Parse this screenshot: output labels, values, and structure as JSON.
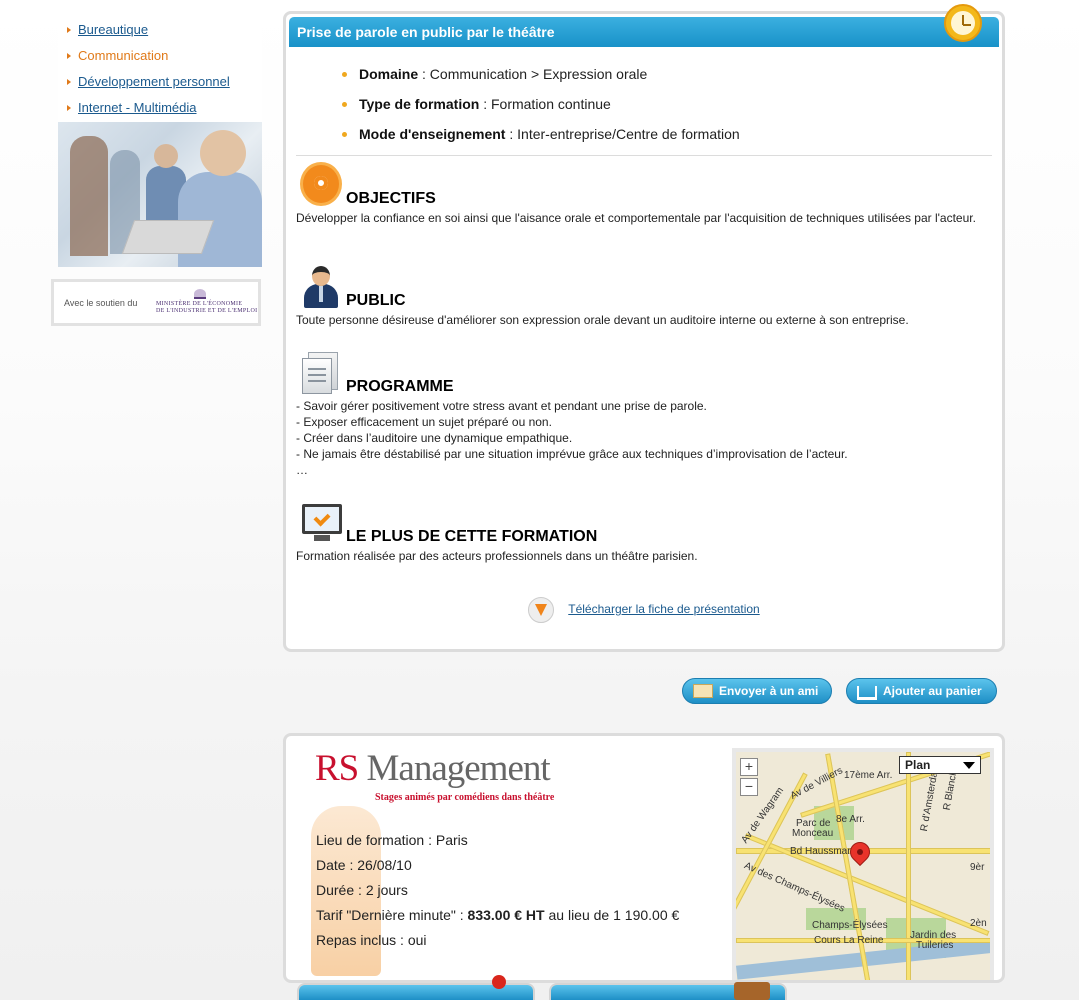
{
  "sidebar": {
    "menu": [
      {
        "label": "Bureautique",
        "active": false
      },
      {
        "label": "Communication",
        "active": true
      },
      {
        "label": "Développement personnel",
        "active": false
      },
      {
        "label": "Internet - Multimédia",
        "active": false
      }
    ],
    "support": {
      "text": "Avec le soutien du",
      "ministry_line1": "MINISTÈRE DE L'ÉCONOMIE",
      "ministry_line2": "DE L'INDUSTRIE ET DE L'EMPLOI"
    }
  },
  "course": {
    "title": "Prise de parole en public par le théâtre",
    "meta": [
      {
        "label": "Domaine",
        "sep": " : ",
        "value": "Communication > Expression orale"
      },
      {
        "label": "Type de formation",
        "sep": " : ",
        "value": "Formation continue"
      },
      {
        "label": "Mode d'enseignement",
        "sep": " : ",
        "value": "Inter-entreprise/Centre de formation"
      }
    ],
    "sections": {
      "objectifs": {
        "title": "OBJECTIFS",
        "icon": "target-icon",
        "body": "Développer la confiance en soi ainsi que l'aisance orale et comportementale par l'acquisition de techniques utilisées par l'acteur."
      },
      "public": {
        "title": "PUBLIC",
        "icon": "person-icon",
        "body": "Toute personne désireuse d'améliorer son expression orale devant un auditoire interne ou externe à son entreprise."
      },
      "programme": {
        "title": "PROGRAMME",
        "icon": "document-icon",
        "lines": [
          "- Savoir gérer positivement votre stress avant et pendant une prise de parole.",
          "- Exposer efficacement un sujet préparé ou non.",
          "- Créer dans l’auditoire une dynamique empathique.",
          "- Ne jamais être déstabilisé par une situation imprévue grâce aux techniques d’improvisation de l’acteur.",
          "…"
        ]
      },
      "plus": {
        "title": "LE PLUS DE CETTE FORMATION",
        "icon": "monitor-check-icon",
        "body": "Formation réalisée par des acteurs professionnels dans un théâtre parisien."
      }
    },
    "download_label": "Télécharger la fiche de présentation"
  },
  "actions": {
    "send_label": "Envoyer à un ami",
    "cart_label": "Ajouter au panier"
  },
  "session": {
    "provider_logo_rs": "RS",
    "provider_logo_rest": " Management",
    "provider_tagline": "Stages animés par comédiens dans théâtre",
    "lieu_label": "Lieu de formation : ",
    "lieu": "Paris",
    "date_label": "Date : ",
    "date": "26/08/10",
    "duree_label": "Durée : ",
    "duree": "2 jours",
    "tarif_label": "Tarif \"Dernière minute\" : ",
    "tarif": "833.00 € HT",
    "tarif_suffix": " au lieu de 1 190.00 €",
    "repas_label": "Repas inclus : ",
    "repas": "oui"
  },
  "map": {
    "type_select": "Plan",
    "zoom_in": "+",
    "zoom_out": "−",
    "labels": [
      "17ème Arr.",
      "Av de Villiers",
      "Av de Wagram",
      "Parc de",
      "Monceau",
      "8e Arr.",
      "Bd Haussmann",
      "Av des Champs-Élysées",
      "Champs-Élysées",
      "Cours La Reine",
      "Jardin des",
      "Tuileries",
      "R d'Amsterdam",
      "R Blanche",
      "9èr",
      "2èn"
    ]
  }
}
